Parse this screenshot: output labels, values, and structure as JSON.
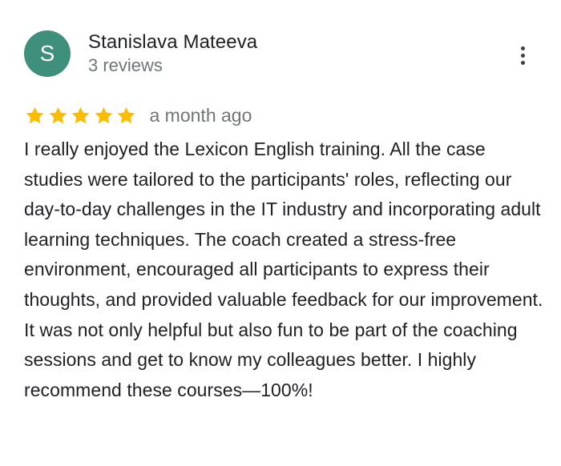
{
  "reviewer": {
    "initial": "S",
    "name": "Stanislava Mateeva",
    "review_count": "3 reviews",
    "avatar_color": "#3f8f7d"
  },
  "menu": {
    "icon": "more-vert-icon"
  },
  "rating": {
    "stars": 5,
    "max_stars": 5,
    "star_color": "#fbbc04",
    "time_ago": "a month ago"
  },
  "review": {
    "text": "I really enjoyed the Lexicon English training. All the case studies were tailored to the participants' roles, reflecting our day-to-day challenges in the IT industry and incorporating adult learning techniques. The coach created a stress-free environment, encouraged all participants to express their thoughts, and provided valuable feedback for our improvement. It was not only helpful but also fun to be part of the coaching sessions and get to know my colleagues better. I highly recommend these courses—100%!"
  }
}
